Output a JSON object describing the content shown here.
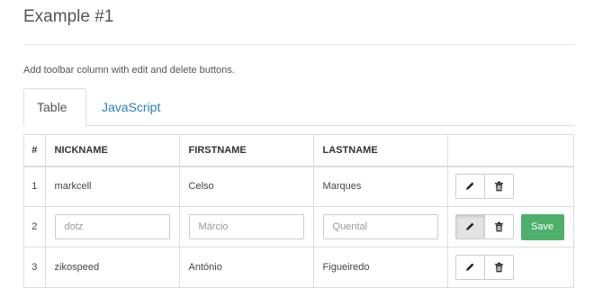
{
  "page": {
    "title": "Example #1",
    "description": "Add toolbar column with edit and delete buttons."
  },
  "tabs": [
    {
      "label": "Table",
      "active": true
    },
    {
      "label": "JavaScript",
      "active": false
    }
  ],
  "table": {
    "headers": [
      "#",
      "NICKNAME",
      "FIRSTNAME",
      "LASTNAME",
      ""
    ],
    "rows": [
      {
        "num": "1",
        "nickname": "markcell",
        "firstname": "Celso",
        "lastname": "Marques",
        "editing": false
      },
      {
        "num": "2",
        "nickname": "dotz",
        "firstname": "Márcio",
        "lastname": "Quental",
        "editing": true
      },
      {
        "num": "3",
        "nickname": "zikospeed",
        "firstname": "António",
        "lastname": "Figueiredo",
        "editing": false
      }
    ]
  },
  "actions": {
    "edit_icon": "pencil-icon",
    "delete_icon": "trash-icon",
    "save_label": "Save"
  },
  "colors": {
    "tab_link": "#2a7fc0",
    "save_button": "#4fb06b",
    "border": "#dddddd"
  }
}
